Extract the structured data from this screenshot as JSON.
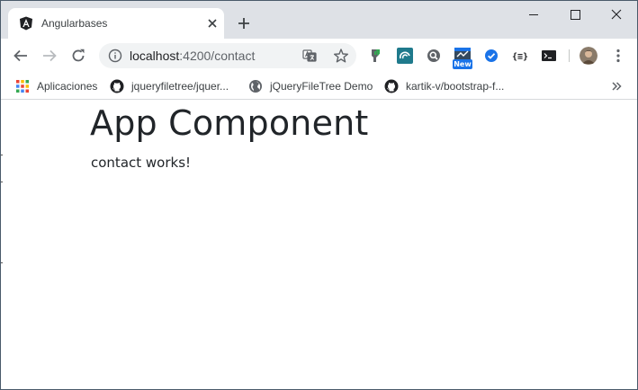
{
  "tab": {
    "title": "Angularbases",
    "favicon": "angular-icon"
  },
  "window_controls": [
    "minimize-icon",
    "maximize-icon",
    "close-icon"
  ],
  "toolbar": {
    "url_host": "localhost",
    "url_path": ":4200/contact",
    "extensions": [
      "ext-green-shield-icon",
      "ext-teal-swirl-icon",
      "ext-search-icon",
      "ext-new-icon",
      "ext-checkmark-icon",
      "ext-json-braces-icon",
      "ext-terminal-icon"
    ],
    "new_badge": "New"
  },
  "bookmarks": [
    {
      "label": "Aplicaciones",
      "icon": "apps-grid-icon"
    },
    {
      "label": "jqueryfiletree/jquer...",
      "icon": "github-icon"
    },
    {
      "label": "jQueryFileTree Demo",
      "icon": "globe-icon"
    },
    {
      "label": "kartik-v/bootstrap-f...",
      "icon": "github-icon"
    }
  ],
  "page": {
    "title": "App Component",
    "text": "contact works!"
  },
  "colors": {
    "tabstrip": "#dee1e6",
    "omnibox": "#f1f3f4",
    "text": "#212529",
    "accent": "#1a73e8"
  }
}
